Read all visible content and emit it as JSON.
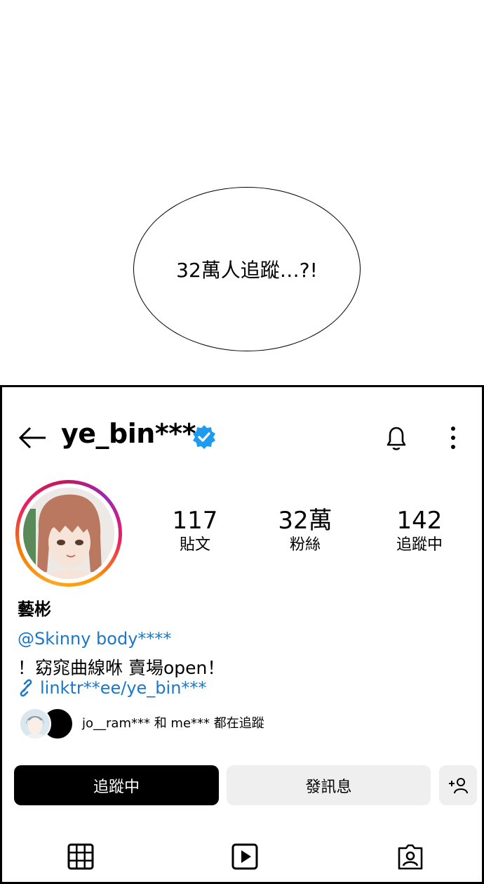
{
  "bubble": {
    "text": "32萬人追蹤…?!"
  },
  "profile": {
    "username": "ye_bin***",
    "stats": {
      "posts": {
        "value": "117",
        "label": "貼文"
      },
      "followers": {
        "value": "32萬",
        "label": "粉絲"
      },
      "following": {
        "value": "142",
        "label": "追蹤中"
      }
    },
    "display_name": "藝彬",
    "bio_mention": "@Skinny body****",
    "bio_text": "！窈窕曲線咻 賣場open！",
    "bio_link": "linktr**ee/ye_bin***",
    "mutual_text": "jo__ram*** 和 me*** 都在追蹤"
  },
  "buttons": {
    "following": "追蹤中",
    "message": "發訊息"
  },
  "icons": {
    "back": "arrow-left-icon",
    "verified": "verified-badge-icon",
    "bell": "bell-icon",
    "more": "more-vertical-icon",
    "link": "link-icon",
    "add_user": "add-user-icon",
    "grid": "grid-icon",
    "reels": "reels-icon",
    "tagged": "tagged-icon"
  },
  "colors": {
    "verified_blue": "#1d9bf0",
    "link_blue": "#1b77c9",
    "primary_button": "#000000",
    "secondary_button": "#efefef"
  }
}
